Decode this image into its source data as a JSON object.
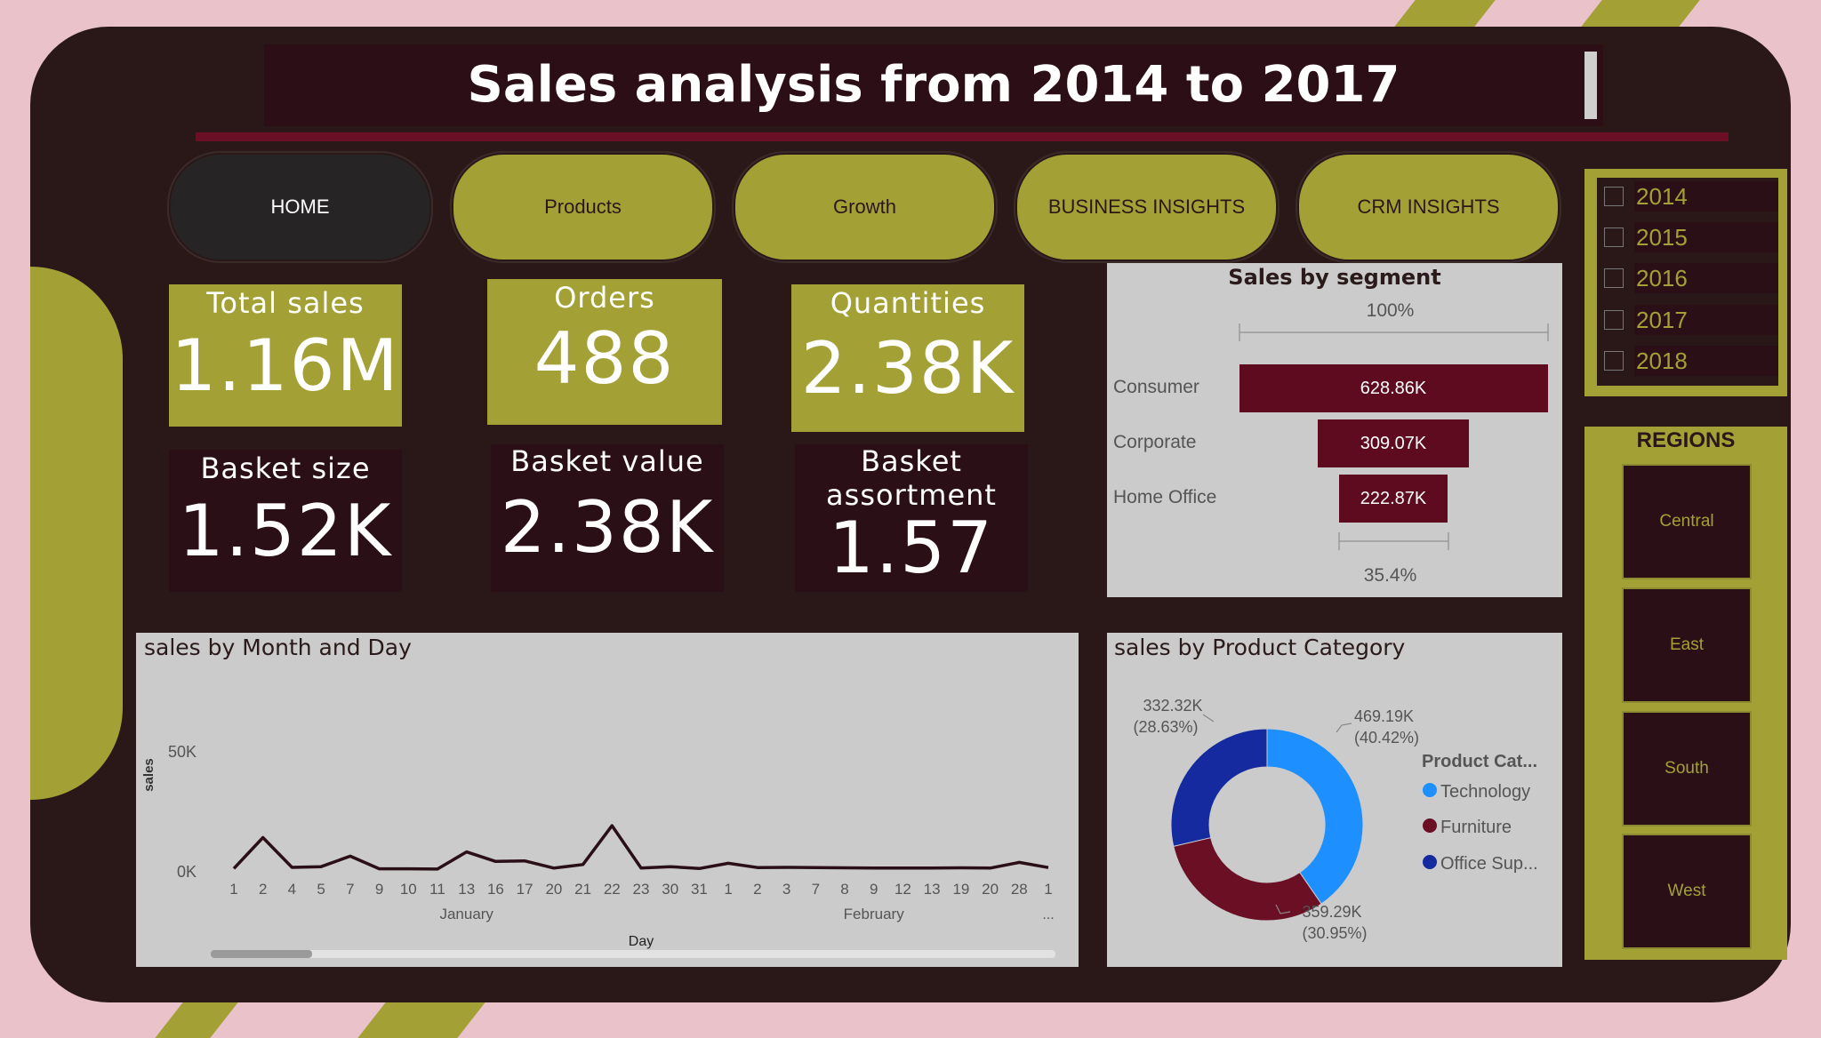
{
  "title": "Sales analysis from 2014 to 2017",
  "nav": [
    {
      "label": "HOME",
      "active": true
    },
    {
      "label": "Products",
      "active": false
    },
    {
      "label": "Growth",
      "active": false
    },
    {
      "label": "BUSINESS INSIGHTS",
      "active": false
    },
    {
      "label": "CRM INSIGHTS",
      "active": false
    }
  ],
  "kpis": {
    "total_sales": {
      "label": "Total sales",
      "value": "1.16M"
    },
    "orders": {
      "label": "Orders",
      "value": "488"
    },
    "quantities": {
      "label": "Quantities",
      "value": "2.38K"
    },
    "basket_size": {
      "label": "Basket size",
      "value": "1.52K"
    },
    "basket_value": {
      "label": "Basket value",
      "value": "2.38K"
    },
    "basket_assortment": {
      "label": "Basket assortment",
      "value": "1.57"
    }
  },
  "years": [
    "2014",
    "2015",
    "2016",
    "2017",
    "2018"
  ],
  "regions": {
    "title": "REGIONS",
    "items": [
      "Central",
      "East",
      "South",
      "West"
    ]
  },
  "colors": {
    "olive": "#a3a136",
    "maroon": "#5e0b1f",
    "background": "#2a1819",
    "technology": "#1e8fff",
    "furniture": "#6a0f24",
    "office": "#142a9e"
  },
  "chart_data": [
    {
      "type": "bar",
      "title": "Sales by segment",
      "top_label": "100%",
      "bottom_label": "35.4%",
      "categories": [
        "Consumer",
        "Corporate",
        "Home Office"
      ],
      "values": [
        628.86,
        309.07,
        222.87
      ],
      "value_labels": [
        "628.86K",
        "309.07K",
        "222.87K"
      ]
    },
    {
      "type": "line",
      "title": "sales by Month and Day",
      "xlabel": "Day",
      "ylabel": "sales",
      "y_ticks": [
        "0K",
        "50K"
      ],
      "ylim": [
        0,
        50000
      ],
      "x_labels": [
        "1",
        "2",
        "4",
        "5",
        "7",
        "9",
        "10",
        "11",
        "13",
        "16",
        "17",
        "20",
        "21",
        "22",
        "23",
        "30",
        "31",
        "1",
        "2",
        "3",
        "7",
        "8",
        "9",
        "12",
        "13",
        "19",
        "20",
        "28",
        "1"
      ],
      "month_labels": [
        {
          "label": "January",
          "at_index": 8
        },
        {
          "label": "February",
          "at_index": 22
        }
      ],
      "more_label": "...",
      "values": [
        1000,
        14000,
        1500,
        1800,
        6200,
        900,
        900,
        800,
        8000,
        4000,
        4200,
        1200,
        2700,
        19000,
        1200,
        1800,
        1000,
        3200,
        1400,
        1500,
        1400,
        1300,
        1200,
        1200,
        1200,
        1300,
        1200,
        3600,
        1400
      ]
    },
    {
      "type": "pie",
      "title": "sales by Product Category",
      "legend_title": "Product Cat...",
      "legend": [
        "Technology",
        "Furniture",
        "Office Sup..."
      ],
      "slices": [
        {
          "name": "Technology",
          "value": 469.19,
          "label": "469.19K",
          "pct": "(40.42%)"
        },
        {
          "name": "Furniture",
          "value": 359.29,
          "label": "359.29K",
          "pct": "(30.95%)"
        },
        {
          "name": "Office Supplies",
          "value": 332.32,
          "label": "332.32K",
          "pct": "(28.63%)"
        }
      ]
    }
  ]
}
